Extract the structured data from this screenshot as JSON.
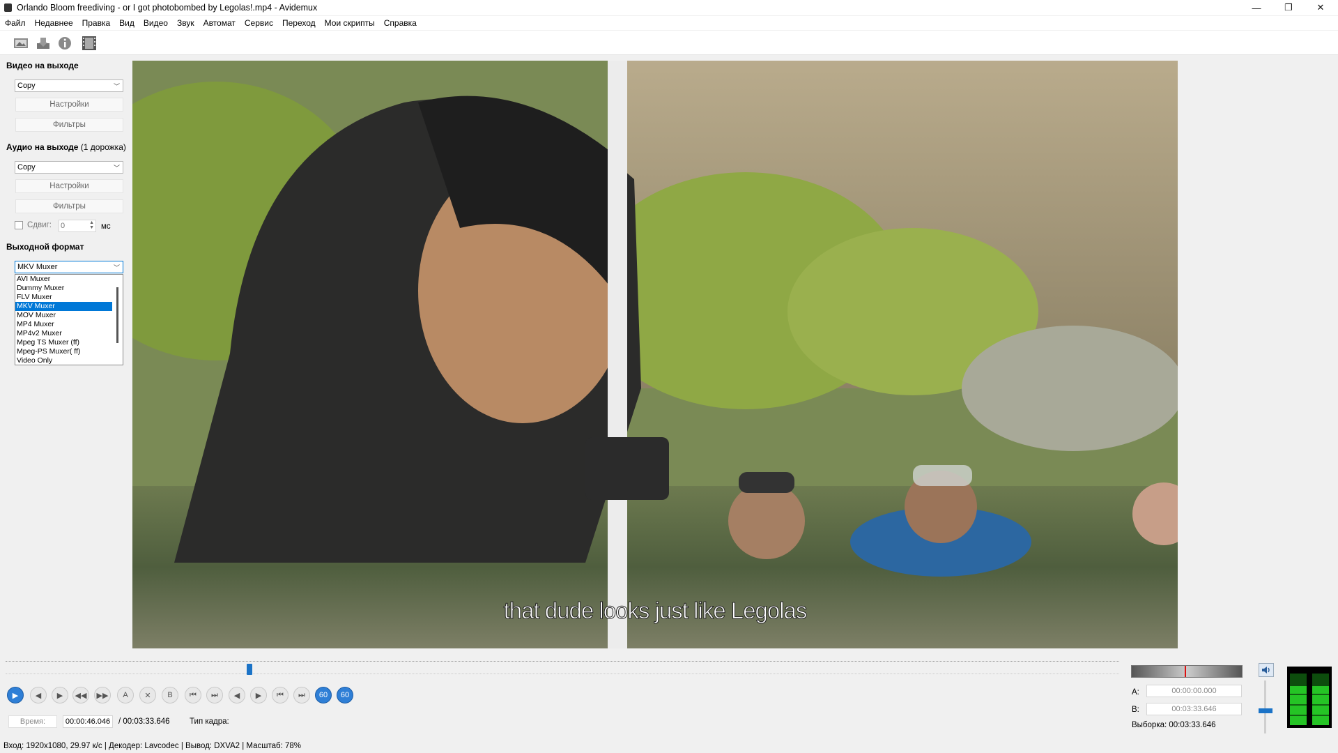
{
  "window": {
    "title": "Orlando Bloom freediving - or I got photobombed by Legolas!.mp4 - Avidemux",
    "controls": {
      "minimize": "—",
      "restore": "❐",
      "close": "✕"
    }
  },
  "menu": [
    "Файл",
    "Недавнее",
    "Правка",
    "Вид",
    "Видео",
    "Звук",
    "Автомат",
    "Сервис",
    "Переход",
    "Мои скрипты",
    "Справка"
  ],
  "toolbar": {
    "icons": [
      "open-image-icon",
      "save-icon",
      "info-icon",
      "film-icon"
    ]
  },
  "left_panel": {
    "video_out": {
      "title": "Видео на выходе",
      "codec": "Copy",
      "settings": "Настройки",
      "filters": "Фильтры"
    },
    "audio_out": {
      "title": "Аудио на выходе",
      "tracks": "(1 дорожка)",
      "codec": "Copy",
      "settings": "Настройки",
      "filters": "Фильтры",
      "shift_label": "Сдвиг:",
      "shift_value": "0",
      "shift_unit": "мс"
    },
    "output_format": {
      "title": "Выходной формат",
      "selected": "MKV Muxer",
      "options": [
        "AVI Muxer",
        "Dummy Muxer",
        "FLV Muxer",
        "MKV Muxer",
        "MOV Muxer",
        "MP4 Muxer",
        "MP4v2 Muxer",
        "Mpeg TS Muxer (ff)",
        "Mpeg-PS Muxer( ff)",
        "Video Only"
      ],
      "selected_index": 3
    }
  },
  "video": {
    "subtitle": "that dude looks just like Legolas"
  },
  "timeline": {
    "position_fraction": 0.2193
  },
  "transport": {
    "buttons": [
      {
        "name": "play-button",
        "glyph": "▶",
        "blue": true
      },
      {
        "name": "prev-frame-button",
        "glyph": "◀"
      },
      {
        "name": "next-frame-button",
        "glyph": "▶"
      },
      {
        "name": "prev-keyframe-button",
        "glyph": "◀◀"
      },
      {
        "name": "next-keyframe-button",
        "glyph": "▶▶"
      },
      {
        "name": "set-marker-a-button",
        "glyph": "A"
      },
      {
        "name": "delete-button",
        "glyph": "✕"
      },
      {
        "name": "set-marker-b-button",
        "glyph": "B"
      },
      {
        "name": "prev-black-button",
        "glyph": "⏮"
      },
      {
        "name": "next-black-button",
        "glyph": "⏭"
      },
      {
        "name": "goto-marker-a-button",
        "glyph": "◀"
      },
      {
        "name": "goto-marker-b-button",
        "glyph": "▶"
      },
      {
        "name": "first-frame-button",
        "glyph": "⏮"
      },
      {
        "name": "last-frame-button",
        "glyph": "⏭"
      },
      {
        "name": "back-60-button",
        "glyph": "60",
        "blue": true
      },
      {
        "name": "forward-60-button",
        "glyph": "60",
        "blue": true
      }
    ]
  },
  "time": {
    "label": "Время:",
    "current": "00:00:46.046",
    "total": "/ 00:03:33.646",
    "frame_type_label": "Тип кадра:"
  },
  "markers": {
    "a_label": "A:",
    "a_value": "00:00:00.000",
    "b_label": "B:",
    "b_value": "00:03:33.646",
    "selection": "Выборка: 00:03:33.646"
  },
  "status": "Вход: 1920x1080, 29.97 к/с  |  Декодер: Lavcodec  |  Вывод: DXVA2  |  Масштаб: 78%",
  "colors": {
    "accent": "#1b73c7",
    "selection": "#0078d7",
    "meter_green": "#2bd62b"
  }
}
